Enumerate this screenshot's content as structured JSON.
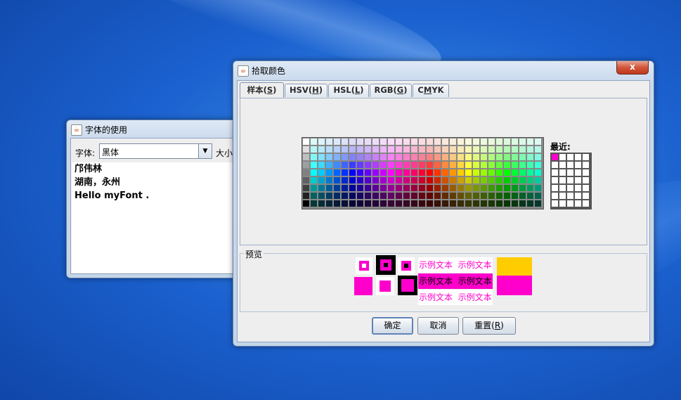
{
  "font_window": {
    "title": "字体的使用",
    "font_label": "字体:",
    "font_value": "黑体",
    "size_label": "大小",
    "text_lines": [
      "邝伟林",
      "湖南，永州",
      "Hello myFont ."
    ]
  },
  "color_chooser": {
    "title": "拾取颜色",
    "close_label": "x",
    "tabs": [
      {
        "pre": "样本(",
        "key": "S",
        "post": ")"
      },
      {
        "pre": "HSV(",
        "key": "H",
        "post": ")"
      },
      {
        "pre": "HSL(",
        "key": "L",
        "post": ")"
      },
      {
        "pre": "RGB(",
        "key": "G",
        "post": ")"
      },
      {
        "pre": "C",
        "key": "M",
        "post": "YK"
      }
    ],
    "selected_tab": 0,
    "recent_label": "最近:",
    "recent_colors": [
      "#ff00cc"
    ],
    "selected_color": "#ff00cc",
    "preview": {
      "label": "预览",
      "sample_text": "示例文本",
      "accent_color": "#ff00cc",
      "secondary_color": "#ffcc00"
    },
    "buttons": {
      "ok": "确定",
      "cancel": "取消",
      "reset_pre": "重置(",
      "reset_key": "R",
      "reset_post": ")"
    }
  },
  "colors": {
    "desktop": "#1b61cf",
    "title_icon_color": "#c2410c"
  }
}
